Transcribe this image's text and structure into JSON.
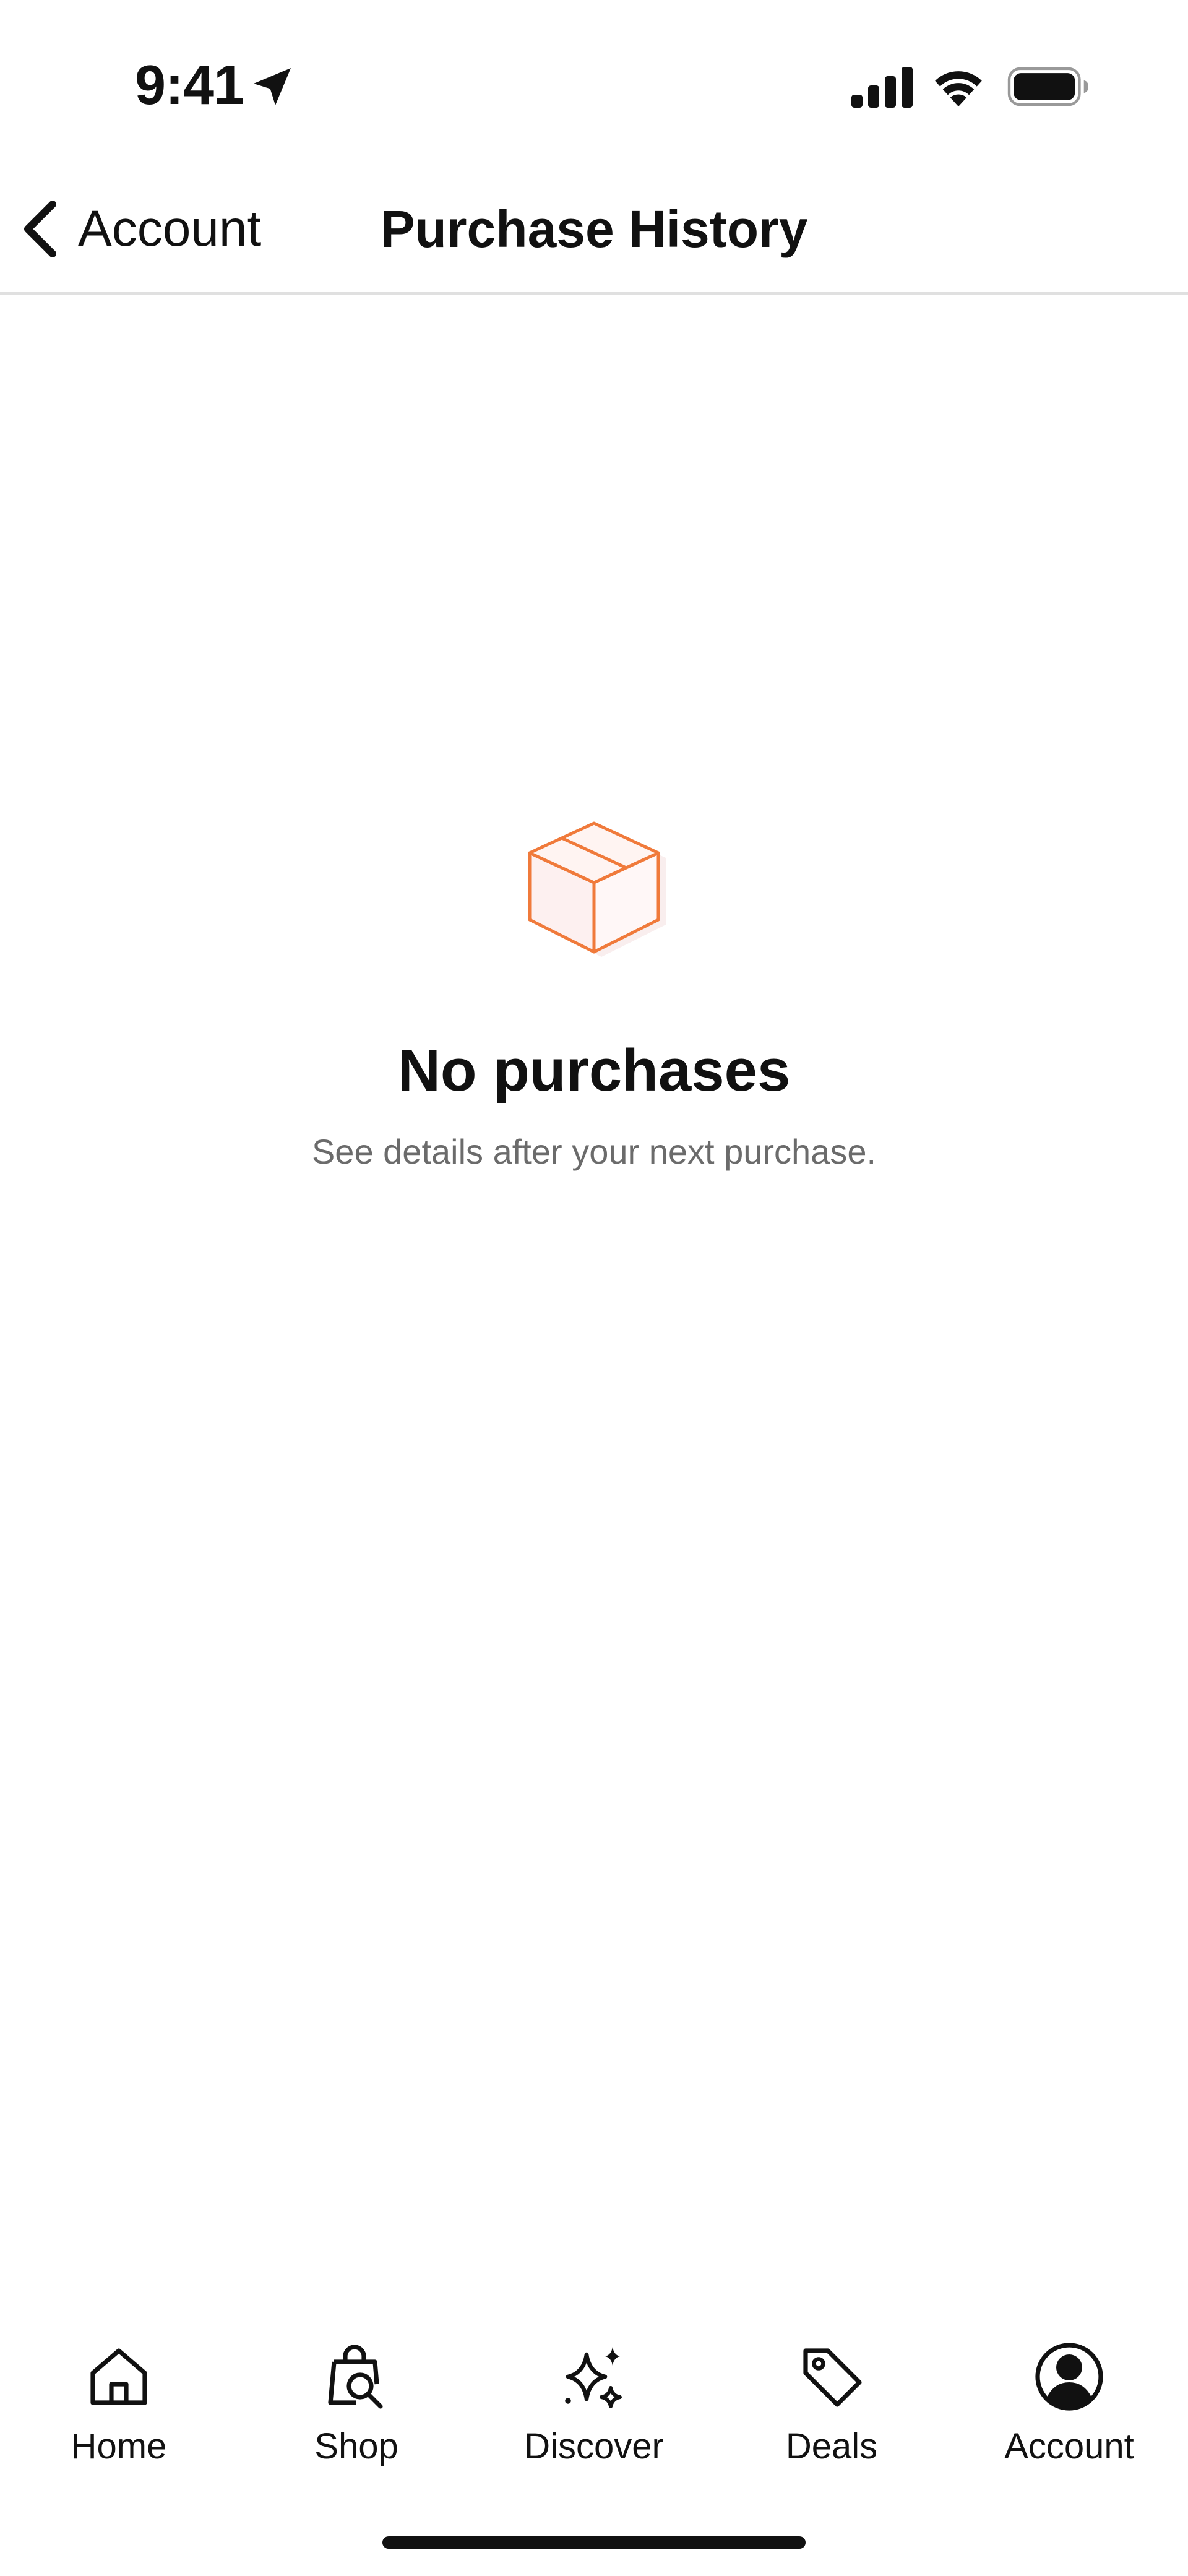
{
  "status_bar": {
    "time": "9:41"
  },
  "nav": {
    "back_label": "Account",
    "title": "Purchase History"
  },
  "empty_state": {
    "icon": "box-icon",
    "icon_color": "#f07a3b",
    "title": "No purchases",
    "subtitle": "See details after your next purchase."
  },
  "tab_bar": {
    "items": [
      {
        "label": "Home",
        "icon": "home-icon"
      },
      {
        "label": "Shop",
        "icon": "shopping-bag-search-icon"
      },
      {
        "label": "Discover",
        "icon": "sparkles-icon"
      },
      {
        "label": "Deals",
        "icon": "tag-icon"
      },
      {
        "label": "Account",
        "icon": "account-icon",
        "selected": true
      }
    ]
  }
}
